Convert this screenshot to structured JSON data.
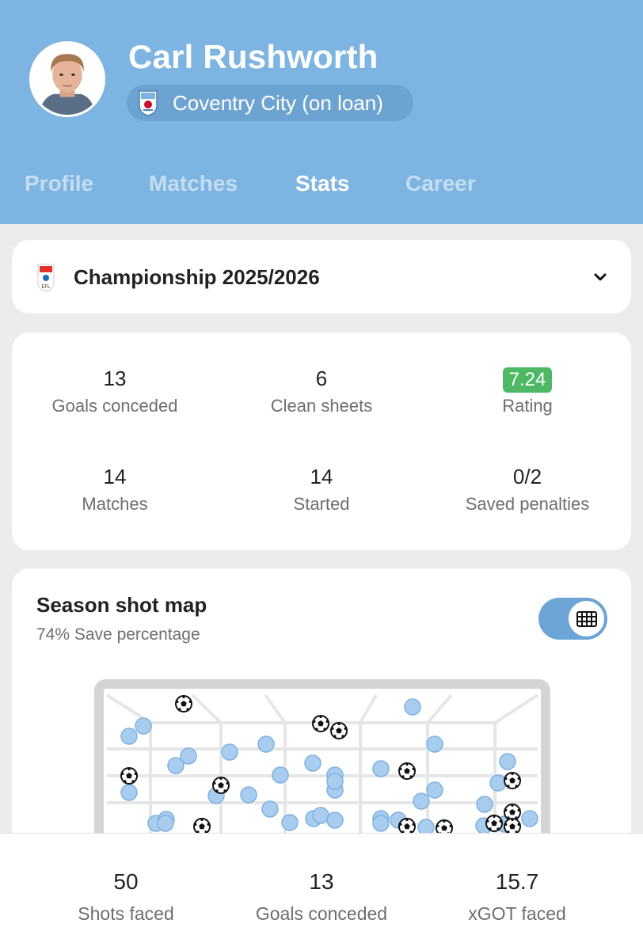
{
  "player": {
    "name": "Carl Rushworth",
    "team": "Coventry City (on loan)"
  },
  "tabs": [
    {
      "label": "Profile",
      "active": false
    },
    {
      "label": "Matches",
      "active": false
    },
    {
      "label": "Stats",
      "active": true
    },
    {
      "label": "Career",
      "active": false
    }
  ],
  "league": {
    "name": "Championship 2025/2026",
    "logo_text": "EFL"
  },
  "stats": [
    {
      "value": "13",
      "label": "Goals conceded"
    },
    {
      "value": "6",
      "label": "Clean sheets"
    },
    {
      "value": "7.24",
      "label": "Rating"
    },
    {
      "value": "14",
      "label": "Matches"
    },
    {
      "value": "14",
      "label": "Started"
    },
    {
      "value": "0/2",
      "label": "Saved penalties"
    }
  ],
  "shotmap": {
    "title": "Season shot map",
    "subtitle": "74% Save percentage",
    "toggle_icon": "goal-net-icon",
    "toggle_on": true,
    "saved_count": 37,
    "goals_count": 13
  },
  "summary": [
    {
      "value": "50",
      "label": "Shots faced"
    },
    {
      "value": "13",
      "label": "Goals conceded"
    },
    {
      "value": "15.7",
      "label": "xGOT faced"
    }
  ],
  "colors": {
    "header_bg": "#7db4e1",
    "saved_shot": "#a9cdef",
    "rating_badge": "#4fb865",
    "toggle": "#6ca4d6"
  }
}
